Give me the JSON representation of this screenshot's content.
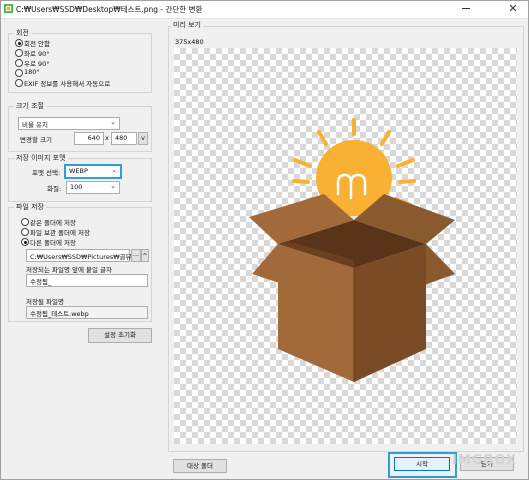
{
  "window": {
    "title": "C:₩Users₩SSD₩Desktop₩테스트.png - 간단한 변환"
  },
  "rotation": {
    "label": "회전",
    "options": [
      "회전 안함",
      "좌로 90°",
      "우로 90°",
      "180°",
      "EXIF 정보를 사용해서 자동으로"
    ],
    "selected_index": 0
  },
  "resize": {
    "label": "크기 조절",
    "mode": "비율 유지",
    "size_label": "변경할 크기",
    "width": "640",
    "x_sep": "x",
    "height": "480",
    "spin_glyph": "v"
  },
  "format": {
    "label": "저장 이미지 포맷",
    "format_label": "포맷 선택:",
    "format_value": "WEBP",
    "quality_label": "화질:",
    "quality_value": "100"
  },
  "save": {
    "label": "파일 저장",
    "options": [
      "같은 폴더에 저장",
      "파일 보관 폴더에 저장",
      "다른 폴더에 저장"
    ],
    "selected_index": 2,
    "path": "C:₩Users₩SSD₩Pictures₩골뷰",
    "browse_label": "...",
    "spin_label": "^",
    "prefix_label": "저장되는 파일명 앞에 붙일 글자",
    "prefix_value": "수정됨_",
    "filename_label": "저장될 파일명",
    "filename_value": "수정됨_테스트.webp"
  },
  "reset_button": "설정 초기화",
  "preview": {
    "label": "미리 보기",
    "size_text": "375x480"
  },
  "bottom": {
    "target_folder_button": "대상 폴더",
    "start_button": "시작",
    "close_button": "닫기"
  },
  "watermark": "IMGBOX",
  "colors": {
    "accent": "#2d9fd8",
    "bulb": "#f8b133",
    "box_light": "#a26a3a",
    "box_dark": "#7a4b25",
    "box_inner": "#5a3418"
  },
  "icons": {
    "app": "app-icon",
    "close": "close-icon",
    "minimize": "minimize-icon",
    "dropdown": "chevron-down-icon"
  }
}
